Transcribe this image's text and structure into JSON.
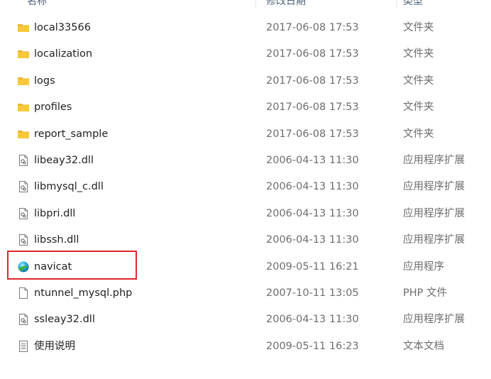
{
  "columns": {
    "name": "名称",
    "modified": "修改日期",
    "type": "类型"
  },
  "files": [
    {
      "name": "local33566",
      "modified": "2017-06-08 17:53",
      "type": "文件夹",
      "icon": "folder-icon"
    },
    {
      "name": "localization",
      "modified": "2017-06-08 17:53",
      "type": "文件夹",
      "icon": "folder-icon"
    },
    {
      "name": "logs",
      "modified": "2017-06-08 17:53",
      "type": "文件夹",
      "icon": "folder-icon"
    },
    {
      "name": "profiles",
      "modified": "2017-06-08 17:53",
      "type": "文件夹",
      "icon": "folder-icon"
    },
    {
      "name": "report_sample",
      "modified": "2017-06-08 17:53",
      "type": "文件夹",
      "icon": "folder-icon"
    },
    {
      "name": "libeay32.dll",
      "modified": "2006-04-13 11:30",
      "type": "应用程序扩展",
      "icon": "dll-file-icon"
    },
    {
      "name": "libmysql_c.dll",
      "modified": "2006-04-13 11:30",
      "type": "应用程序扩展",
      "icon": "dll-file-icon"
    },
    {
      "name": "libpri.dll",
      "modified": "2006-04-13 11:30",
      "type": "应用程序扩展",
      "icon": "dll-file-icon"
    },
    {
      "name": "libssh.dll",
      "modified": "2006-04-13 11:30",
      "type": "应用程序扩展",
      "icon": "dll-file-icon"
    },
    {
      "name": "navicat",
      "modified": "2009-05-11 16:21",
      "type": "应用程序",
      "icon": "navicat-app-icon"
    },
    {
      "name": "ntunnel_mysql.php",
      "modified": "2007-10-11 13:05",
      "type": "PHP 文件",
      "icon": "blank-file-icon"
    },
    {
      "name": "ssleay32.dll",
      "modified": "2006-04-13 11:30",
      "type": "应用程序扩展",
      "icon": "dll-file-icon"
    },
    {
      "name": "使用说明",
      "modified": "2009-05-11 16:23",
      "type": "文本文档",
      "icon": "text-file-icon"
    }
  ],
  "highlight": {
    "target": "navicat",
    "color": "#e0262c"
  },
  "colors": {
    "folder": "#f8c83a",
    "date_text": "#6d6d6d",
    "header_text": "#4c607a"
  }
}
